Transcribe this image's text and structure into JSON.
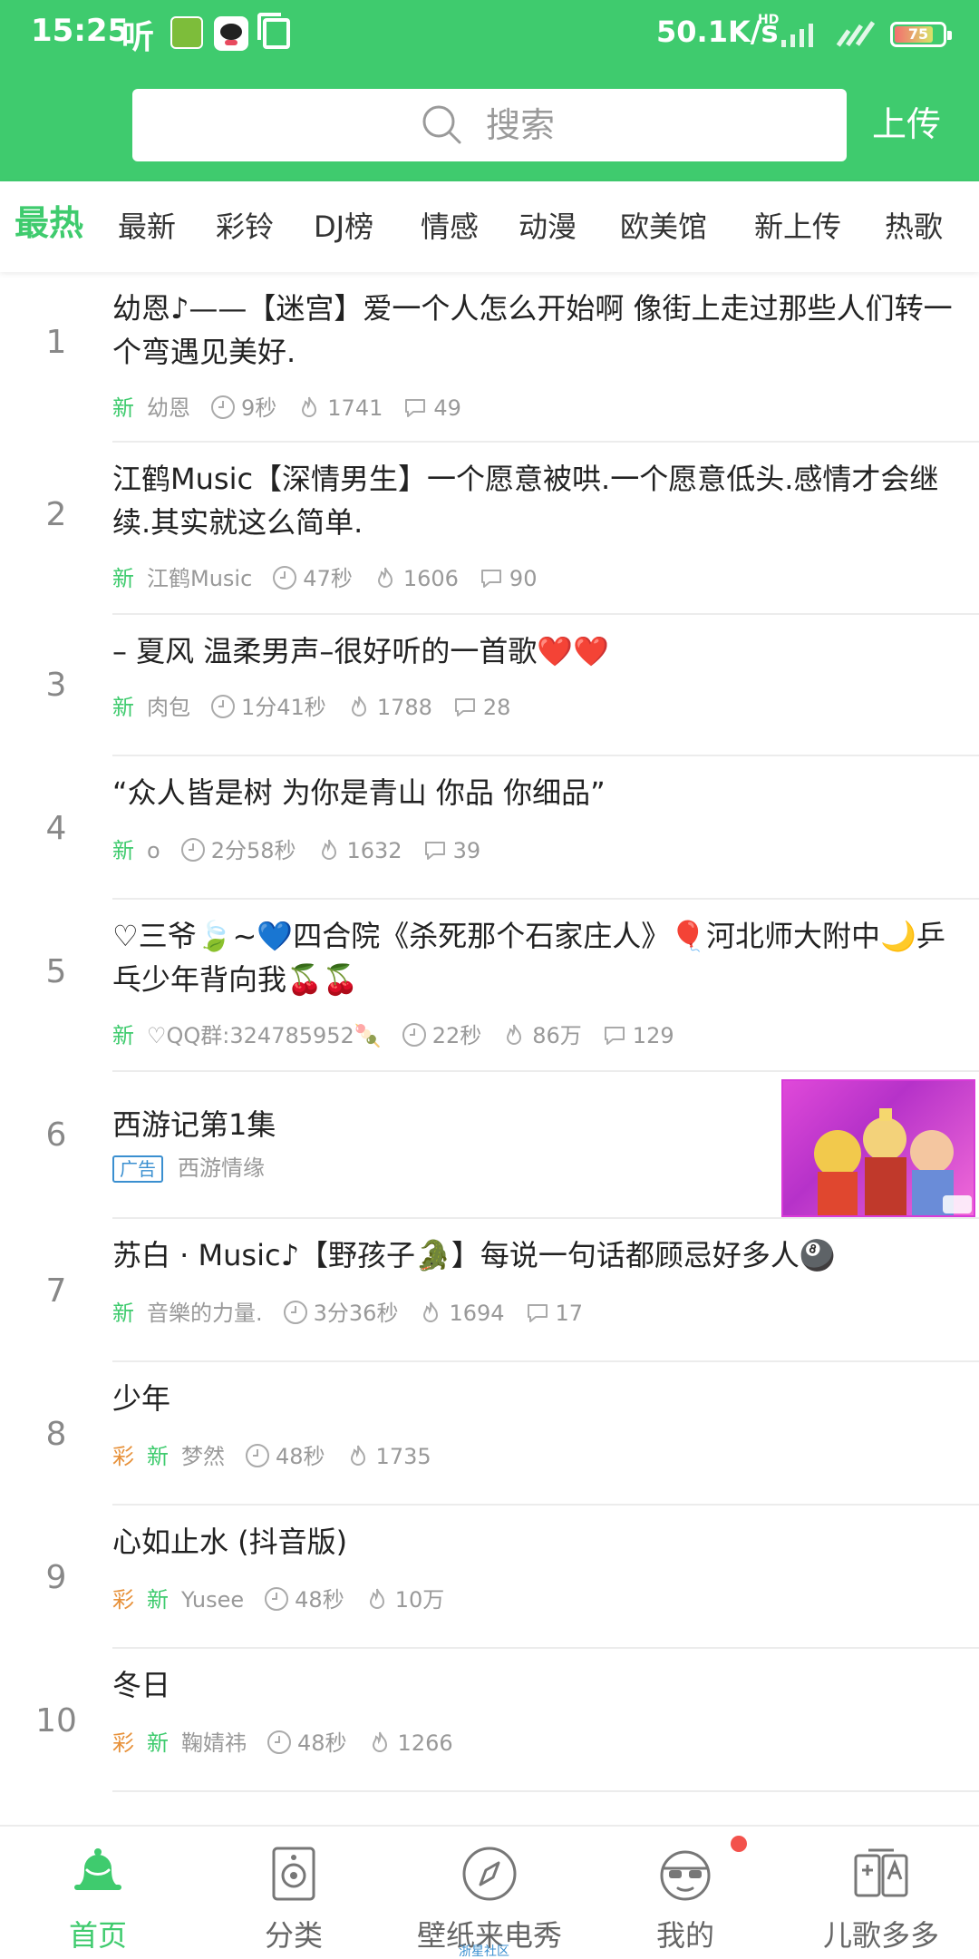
{
  "status_bar": {
    "time": "15:25",
    "ting_icon_text": "听",
    "speed": "50.1K/s",
    "hd": "HD",
    "battery": "75"
  },
  "header": {
    "search_placeholder": "搜索",
    "upload_label": "上传",
    "accent_color": "#3fcb6e"
  },
  "tabs": [
    {
      "label": "最热",
      "active": true
    },
    {
      "label": "最新"
    },
    {
      "label": "彩铃"
    },
    {
      "label": "DJ榜"
    },
    {
      "label": "情感"
    },
    {
      "label": "动漫"
    },
    {
      "label": "欧美馆"
    },
    {
      "label": "新上传"
    },
    {
      "label": "热歌"
    }
  ],
  "items": [
    {
      "rank": "1",
      "title": "幼恩♪——【迷宫】爱一个人怎么开始啊 像街上走过那些人们转一个弯遇见美好.",
      "tag_new": "新",
      "author": "幼恩",
      "duration": "9秒",
      "plays": "1741",
      "comments": "49"
    },
    {
      "rank": "2",
      "title": "江鹤Music【深情男生】一个愿意被哄.一个愿意低头.感情才会继续.其实就这么简单.",
      "tag_new": "新",
      "author": "江鹤Music",
      "duration": "47秒",
      "plays": "1606",
      "comments": "90"
    },
    {
      "rank": "3",
      "title": "– 夏风 温柔男声–很好听的一首歌❤️❤️",
      "tag_new": "新",
      "author": "肉包",
      "duration": "1分41秒",
      "plays": "1788",
      "comments": "28"
    },
    {
      "rank": "4",
      "title": "“众人皆是树 为你是青山 你品 你细品”",
      "tag_new": "新",
      "author": "o",
      "duration": "2分58秒",
      "plays": "1632",
      "comments": "39"
    },
    {
      "rank": "5",
      "title": "♡三爷🍃~💙四合院《杀死那个石家庄人》🎈河北师大附中🌙乒乓少年背向我🍒🍒",
      "tag_new": "新",
      "author": "♡QQ群:324785952🍡",
      "duration": "22秒",
      "plays": "86万",
      "comments": "129"
    },
    {
      "rank": "6",
      "title": "西游记第1集",
      "ad_tag": "广告",
      "author": "西游情缘"
    },
    {
      "rank": "7",
      "title": "苏白 · Music♪【野孩子🐊】每说一句话都顾忌好多人🎱",
      "tag_new": "新",
      "author": "音樂的力量.",
      "duration": "3分36秒",
      "plays": "1694",
      "comments": "17"
    },
    {
      "rank": "8",
      "title": "少年",
      "tag_cai": "彩",
      "tag_new": "新",
      "author": "梦然",
      "duration": "48秒",
      "plays": "1735"
    },
    {
      "rank": "9",
      "title": "心如止水 (抖音版)",
      "tag_cai": "彩",
      "tag_new": "新",
      "author": "Yusee",
      "duration": "48秒",
      "plays": "10万"
    },
    {
      "rank": "10",
      "title": "冬日",
      "tag_cai": "彩",
      "tag_new": "新",
      "author": "鞠婧祎",
      "duration": "48秒",
      "plays": "1266"
    }
  ],
  "bottom_nav": [
    {
      "label": "首页",
      "icon": "bell-icon",
      "active": true
    },
    {
      "label": "分类",
      "icon": "speaker-icon"
    },
    {
      "label": "壁纸来电秀",
      "icon": "compass-icon"
    },
    {
      "label": "我的",
      "icon": "avatar-icon"
    },
    {
      "label": "儿歌多多",
      "icon": "kids-book-icon"
    }
  ],
  "bottom_nav_sub": "浙星社区"
}
